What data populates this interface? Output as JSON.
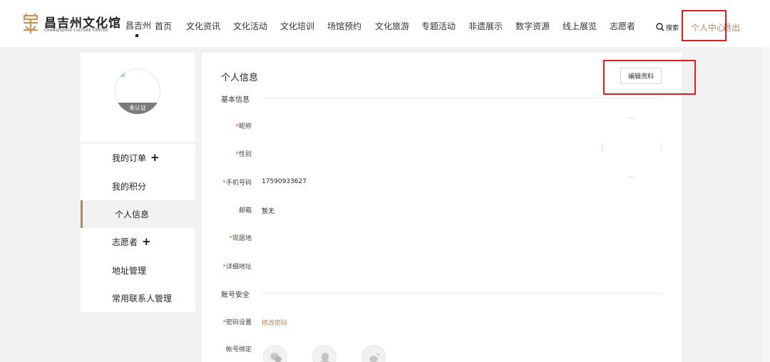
{
  "header": {
    "logo_cn": "昌吉州文化馆",
    "logo_en": "CHANGJIZHOU CULTURE CENTER",
    "city": "昌吉州",
    "nav": [
      "首页",
      "文化资讯",
      "文化活动",
      "文化培训",
      "场馆预约",
      "文化旅游",
      "专题活动",
      "非遗展示",
      "数字资源",
      "线上展览",
      "志愿者"
    ],
    "search_label": "搜索",
    "user_center": "个人中心",
    "logout": "退出"
  },
  "profile": {
    "badge": "未认证"
  },
  "sidebar": {
    "items": [
      {
        "label": "我的订单",
        "plus": "+"
      },
      {
        "label": "我的积分",
        "plus": ""
      },
      {
        "label": "个人信息",
        "plus": ""
      },
      {
        "label": "志愿者",
        "plus": "+"
      },
      {
        "label": "地址管理",
        "plus": ""
      },
      {
        "label": "常用联系人管理",
        "plus": ""
      }
    ],
    "active_index": 2
  },
  "main": {
    "title": "个人信息",
    "edit_button": "编辑资料",
    "basic_section": "基本信息",
    "security_section": "账号安全",
    "fields": {
      "nickname_label": "昵称",
      "gender_label": "性别",
      "phone_label": "手机号码",
      "phone_value": "17590933627",
      "email_label": "邮箱",
      "email_value": "暂无",
      "residence_label": "现居地",
      "address_label": "详细地址",
      "password_label": "密码设置",
      "password_link": "修改密码",
      "binding_label": "帐号绑定"
    },
    "required_mark": "*"
  },
  "colors": {
    "accent": "#b38a5a",
    "highlight": "#e31b1b",
    "required": "#e25a3a"
  },
  "icons": [
    "search-icon",
    "wechat-icon",
    "qq-icon",
    "weibo-icon",
    "plus-icon",
    "logo-mark-icon"
  ]
}
